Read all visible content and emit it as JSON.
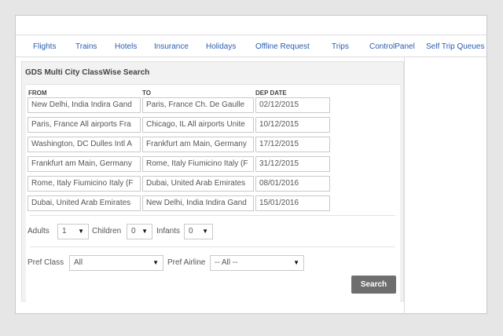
{
  "nav": {
    "items": [
      {
        "label": "Flights"
      },
      {
        "label": "Trains"
      },
      {
        "label": "Hotels"
      },
      {
        "label": "Insurance"
      },
      {
        "label": "Holidays"
      },
      {
        "label": "Offline Request"
      },
      {
        "label": "Trips"
      },
      {
        "label": "ControlPanel"
      },
      {
        "label": "Self Trip Queues"
      }
    ]
  },
  "search": {
    "title": "GDS Multi City ClassWise Search",
    "columns": {
      "from": "FROM",
      "to": "TO",
      "dep_date": "DEP DATE"
    },
    "legs": [
      {
        "from": "New Delhi, India Indira Gand",
        "to": "Paris, France Ch. De Gaulle",
        "date": "02/12/2015"
      },
      {
        "from": "Paris, France All airports Fra",
        "to": "Chicago, IL All airports Unite",
        "date": "10/12/2015"
      },
      {
        "from": "Washington, DC Dulles Intl A",
        "to": "Frankfurt am Main, Germany",
        "date": "17/12/2015"
      },
      {
        "from": "Frankfurt am Main, Germany",
        "to": "Rome, Italy Fiumicino Italy (F",
        "date": "31/12/2015"
      },
      {
        "from": "Rome, Italy Fiumicino Italy (F",
        "to": "Dubai, United Arab Emirates",
        "date": "08/01/2016"
      },
      {
        "from": "Dubai, United Arab Emirates",
        "to": "New Delhi, India Indira Gand",
        "date": "15/01/2016"
      }
    ],
    "passengers": {
      "adults_label": "Adults",
      "adults_value": "1",
      "children_label": "Children",
      "children_value": "0",
      "infants_label": "Infants",
      "infants_value": "0"
    },
    "prefs": {
      "class_label": "Pref Class",
      "class_value": "All",
      "airline_label": "Pref Airline",
      "airline_value": "-- All --"
    },
    "search_label": "Search"
  },
  "icons": {
    "dropdown": "caret-down-icon"
  },
  "colors": {
    "nav_link": "#2a5db0",
    "button": "#6e6e6e"
  }
}
